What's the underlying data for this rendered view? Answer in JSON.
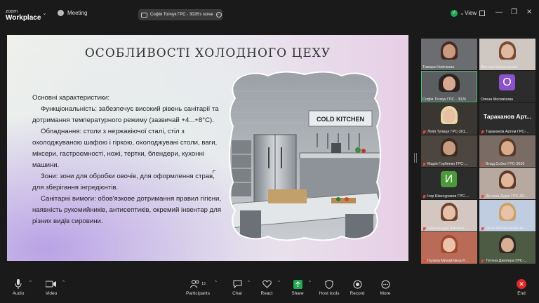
{
  "app": {
    "logo_line1": "zoom",
    "logo_line2": "Workplace",
    "meeting_label": "Meeting",
    "share_title": "Софія Толчук ГРС - 3026's scree",
    "view_label": "View"
  },
  "slide": {
    "title": "ОСОБЛИВОСТІ ХОЛОДНОГО ЦЕХУ",
    "paragraphs": [
      "Основні характеристики:",
      "Функціональність: забезпечує високий рівень санітарії та дотримання температурного режиму (зазвичай +4...+8°С).",
      "Обладнання: столи з нержавіючої сталі, стіл з охолоджуваною шафою і гіркою, охолоджувані столи, ваги, міксери, гастроємності, ножі, тертки, блендери, кухонні машини.",
      "Зони: зони для обробки овочів, для оформлення страв, для зберігання інгредієнтів.",
      "Санітарні вимоги: обов'язкове дотримання правил гігієни, наявність рукомийників, антисептиків, окремий інвентар для різних видів сировини."
    ],
    "image_sign": "COLD KITCHEN"
  },
  "participants": [
    {
      "name": "Тамара Новічкова"
    },
    {
      "name": "Вікторія Кожевнікова"
    },
    {
      "name": "Софія Толчук ГРС - 3026"
    },
    {
      "name": "Олена Москвічова",
      "initial": "О"
    },
    {
      "name": "Лілія Тупиця ГРС-301..."
    },
    {
      "name": "Тараканов Артем ГРС-...",
      "display_text": "Тараканов  Арт..."
    },
    {
      "name": "Марія Горбенко ГРС-..."
    },
    {
      "name": "Влад Собко ГРС-3026"
    },
    {
      "name": "Ігор Шахнуразов ГРС-...",
      "initial": "И"
    },
    {
      "name": "Дінчева Дарія ГРС-30..."
    },
    {
      "name": "Олександра Амеліна ..."
    },
    {
      "name": "Daria Mikhalchenko гр..."
    },
    {
      "name": "Галина Михайлівна Р..."
    },
    {
      "name": "Тетяна Джопера ГРС-..."
    }
  ],
  "toolbar": {
    "audio": "Audio",
    "video": "Video",
    "participants": "Participants",
    "participants_count": "13",
    "chat": "Chat",
    "react": "React",
    "share": "Share",
    "host_tools": "Host tools",
    "record": "Record",
    "more": "More",
    "end": "End"
  },
  "colors": {
    "background": "#1a1a1a",
    "accent_green": "#23a853",
    "mute_red": "#e8493f",
    "end_red": "#e02828",
    "active_speaker": "#49c07a",
    "olena_avatar": "#8b52c9",
    "igor_avatar": "#4a9a3a"
  },
  "icons": [
    "paw-icon",
    "monitor-icon",
    "more-icon",
    "shield-check-icon",
    "grid-icon",
    "minimize-icon",
    "restore-icon",
    "close-icon",
    "mic-icon",
    "camera-icon",
    "people-icon",
    "chat-icon",
    "heart-icon",
    "share-up-icon",
    "shield-icon",
    "record-icon",
    "more-dots-icon",
    "end-x-icon"
  ]
}
